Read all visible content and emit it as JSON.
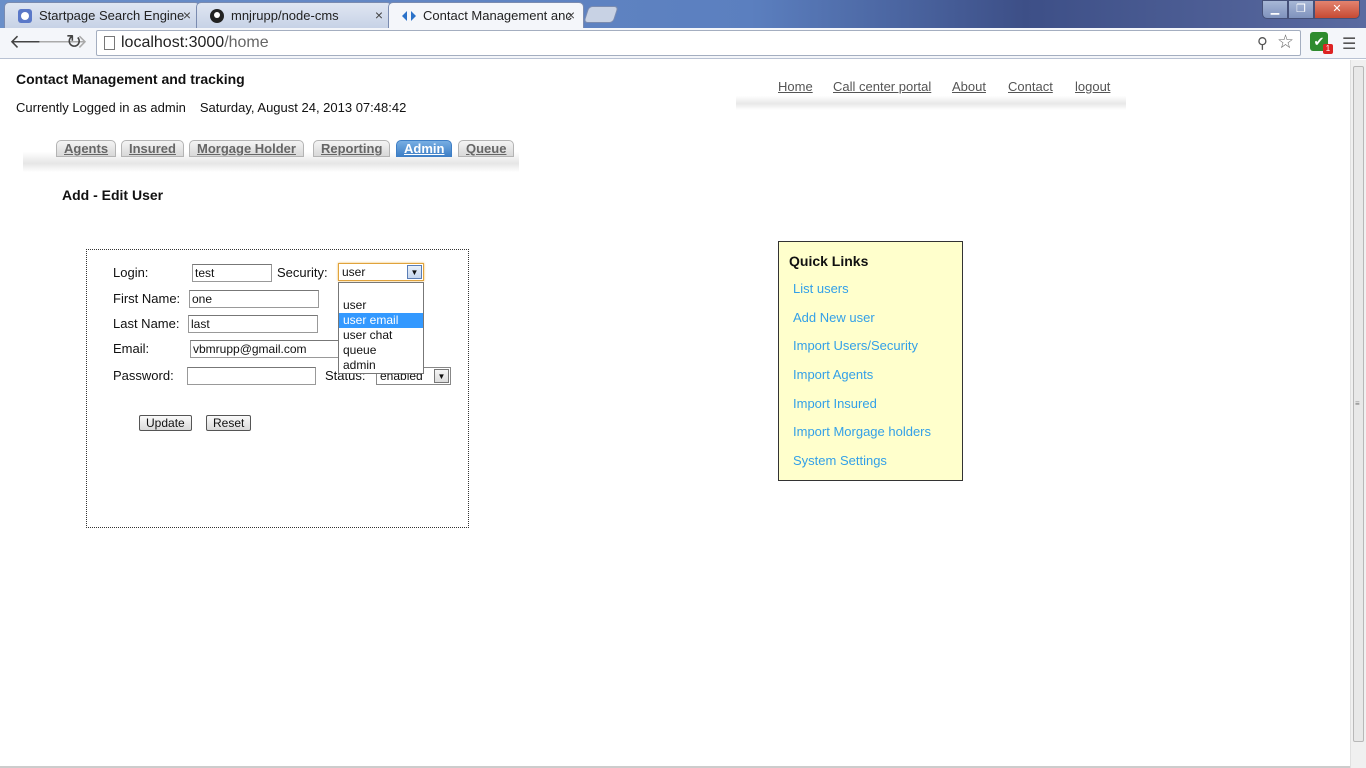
{
  "browser": {
    "tabs": [
      {
        "title": "Startpage Search Engine",
        "icon": "startpage-icon"
      },
      {
        "title": "mnjrupp/node-cms",
        "icon": "github-icon"
      },
      {
        "title": "Contact Management anc",
        "icon": "app-icon"
      }
    ],
    "url_host": "localhost:3000",
    "url_path": "/home",
    "extension_badge_count": "1"
  },
  "header": {
    "app_title": "Contact Management and tracking",
    "logged_in_text": "Currently Logged in as admin",
    "datetime": "Saturday, August 24, 2013 07:48:42"
  },
  "topnav": [
    "Home",
    "Call center portal",
    "About",
    "Contact",
    "logout"
  ],
  "apptabs": [
    "Agents",
    "Insured",
    "Morgage Holder",
    "Reporting",
    "Admin",
    "Queue"
  ],
  "active_apptab": "Admin",
  "section_title": "Add - Edit User",
  "form": {
    "login_label": "Login:",
    "login_value": "test",
    "security_label": "Security:",
    "security_value": "user",
    "security_options": [
      "user",
      "user email",
      "user chat",
      "queue",
      "admin"
    ],
    "security_highlighted": "user email",
    "firstname_label": "First Name:",
    "firstname_value": "one",
    "lastname_label": "Last Name:",
    "lastname_value": "last",
    "email_label": "Email:",
    "email_value": "vbmrupp@gmail.com",
    "password_label": "Password:",
    "password_value": "",
    "status_label": "Status:",
    "status_value": "enabled",
    "update_button": "Update",
    "reset_button": "Reset"
  },
  "quicklinks": {
    "title": "Quick Links",
    "links": [
      "List users",
      "Add New user",
      "Import Users/Security",
      "Import Agents",
      "Import Insured",
      "Import Morgage holders",
      "System Settings"
    ]
  },
  "colors": {
    "link_blue": "#33a0e8",
    "quicklinks_bg": "#ffffcc",
    "active_tab": "#3f7fc6",
    "selected_option": "#3399ff"
  }
}
